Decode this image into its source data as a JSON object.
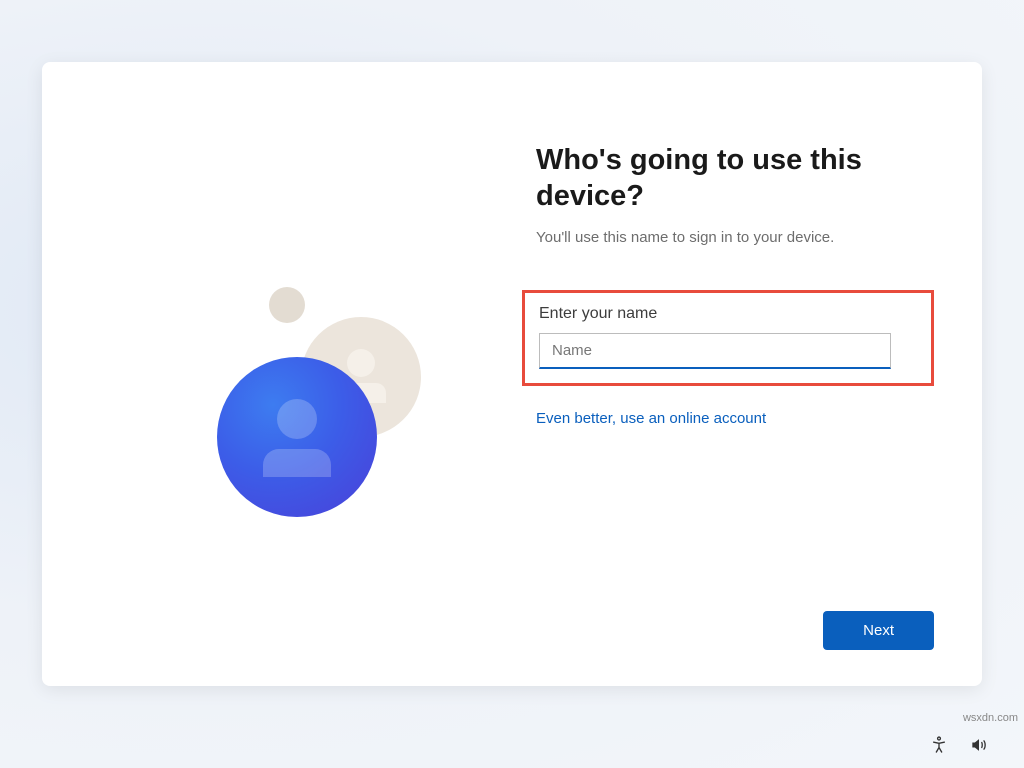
{
  "card": {
    "title": "Who's going to use this device?",
    "subtitle": "You'll use this name to sign in to your device.",
    "field_label": "Enter your name",
    "name_placeholder": "Name",
    "online_link": "Even better, use an online account",
    "next_label": "Next"
  },
  "watermark": "wsxdn.com"
}
